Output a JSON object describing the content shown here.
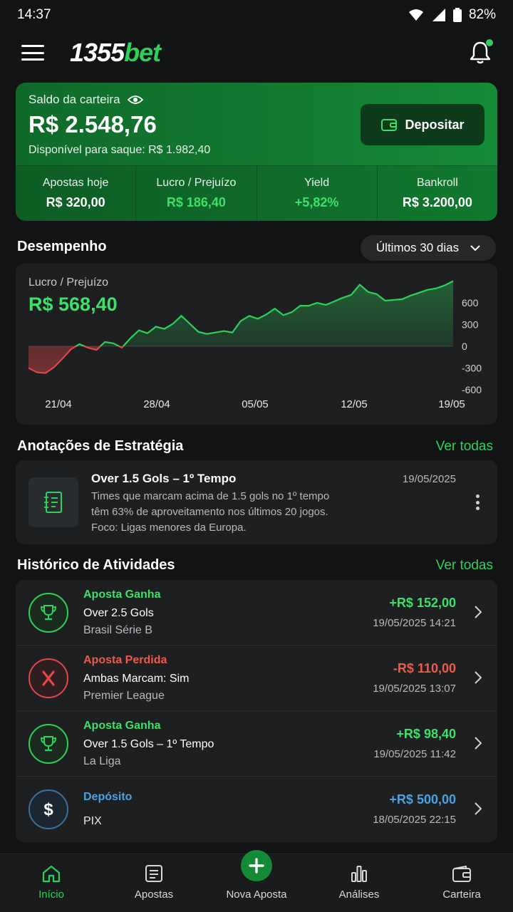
{
  "status": {
    "time": "14:37",
    "battery": "82%"
  },
  "header": {
    "logo_num": "1355",
    "logo_bet": "bet"
  },
  "wallet": {
    "label": "Saldo da carteira",
    "balance": "R$ 2.548,76",
    "available_label": "Disponível para saque:",
    "available_value": "R$ 1.982,40",
    "deposit_label": "Depositar",
    "stats": [
      {
        "label": "Apostas hoje",
        "value": "R$ 320,00"
      },
      {
        "label": "Lucro / Prejuízo",
        "value": "R$ 186,40"
      },
      {
        "label": "Yield",
        "value": "+5,82%"
      },
      {
        "label": "Bankroll",
        "value": "R$ 3.200,00"
      }
    ]
  },
  "performance": {
    "title": "Desempenho",
    "period": "Últimos 30 dias",
    "chart_label": "Lucro / Prejuízo",
    "chart_value": "R$ 568,40"
  },
  "chart_data": {
    "type": "area",
    "y_ticks": [
      "600",
      "300",
      "0",
      "-300",
      "-600"
    ],
    "x_ticks": [
      "21/04",
      "28/04",
      "05/05",
      "12/05",
      "19/05"
    ],
    "ylim": [
      -600,
      600
    ],
    "values": [
      -300,
      -360,
      -370,
      -290,
      -170,
      -40,
      30,
      -20,
      -50,
      60,
      40,
      -20,
      110,
      220,
      180,
      270,
      240,
      310,
      420,
      310,
      200,
      170,
      190,
      210,
      190,
      350,
      420,
      380,
      440,
      520,
      430,
      470,
      560,
      560,
      600,
      570,
      620,
      670,
      710,
      850,
      750,
      720,
      630,
      640,
      650,
      700,
      740,
      780,
      800,
      840,
      900
    ]
  },
  "notes": {
    "title": "Anotações de Estratégia",
    "see_all": "Ver todas",
    "item": {
      "title": "Over 1.5 Gols – 1º Tempo",
      "date": "19/05/2025",
      "line1": "Times que marcam acima de 1.5 gols no 1º tempo",
      "line2": "têm 63% de aproveitamento nos últimos 20 jogos.",
      "line3": "Foco: Ligas menores da Europa."
    }
  },
  "activity": {
    "title": "Histórico de Atividades",
    "see_all": "Ver todas",
    "items": [
      {
        "type": "Aposta Ganha",
        "title": "Over 2.5 Gols",
        "sub": "Brasil Série B",
        "amount": "+R$ 152,00",
        "date": "19/05/2025 14:21"
      },
      {
        "type": "Aposta Perdida",
        "title": "Ambas Marcam: Sim",
        "sub": "Premier League",
        "amount": "-R$ 110,00",
        "date": "19/05/2025 13:07"
      },
      {
        "type": "Aposta Ganha",
        "title": "Over 1.5 Gols – 1º Tempo",
        "sub": "La Liga",
        "amount": "+R$ 98,40",
        "date": "19/05/2025 11:42"
      },
      {
        "type": "Depósito",
        "title": "PIX",
        "amount": "+R$ 500,00",
        "date": "18/05/2025 22:15"
      }
    ]
  },
  "nav": {
    "items": [
      {
        "label": "Início"
      },
      {
        "label": "Apostas"
      },
      {
        "label": "Nova Aposta"
      },
      {
        "label": "Análises"
      },
      {
        "label": "Carteira"
      }
    ]
  },
  "colors": {
    "accent": "#2dd05a",
    "loss": "#ef5a4a",
    "deposit": "#4aa3e0",
    "background": "#121314"
  }
}
